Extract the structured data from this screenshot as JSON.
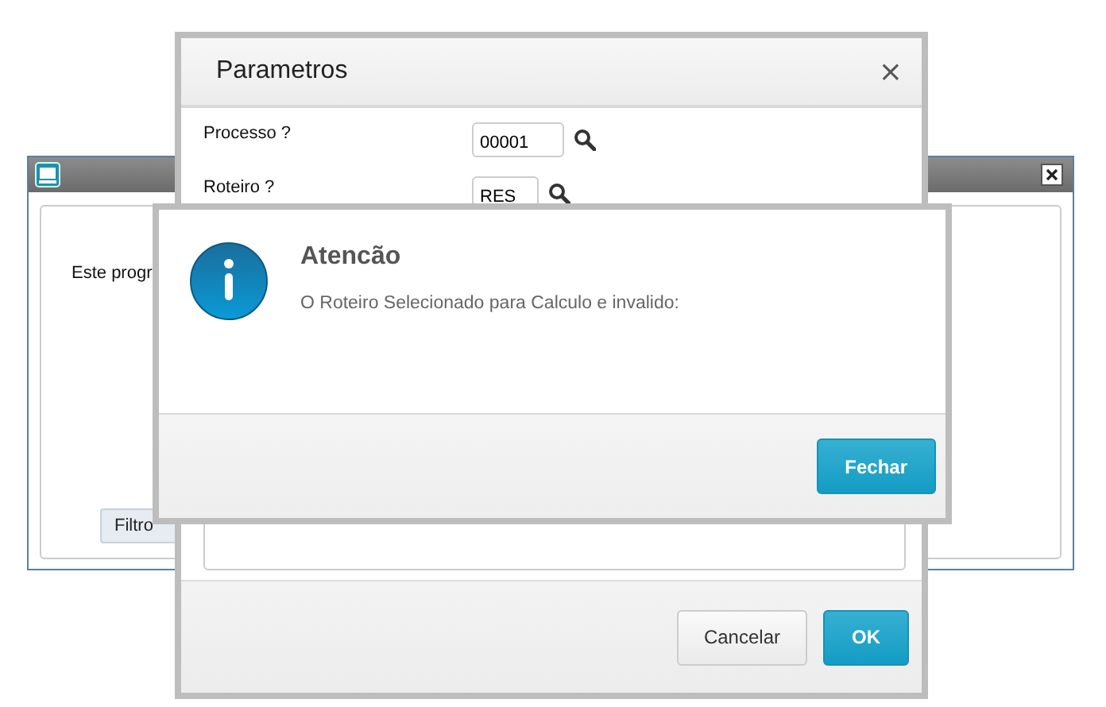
{
  "background_window": {
    "text": "Este progr",
    "button": "Filtro"
  },
  "parameters_dialog": {
    "title": "Parametros",
    "close": "×",
    "fields": [
      {
        "label": "Processo ?",
        "value": "00001"
      },
      {
        "label": "Roteiro ?",
        "value": "RES"
      }
    ],
    "buttons": [
      {
        "label": "Cancelar",
        "primary": false
      },
      {
        "label": "OK",
        "primary": true
      }
    ]
  },
  "alert": {
    "title": "Atencão",
    "message": "O Roteiro Selecionado para Calculo e invalido:",
    "buttons": [
      {
        "label": "Fechar",
        "primary": true
      }
    ]
  }
}
